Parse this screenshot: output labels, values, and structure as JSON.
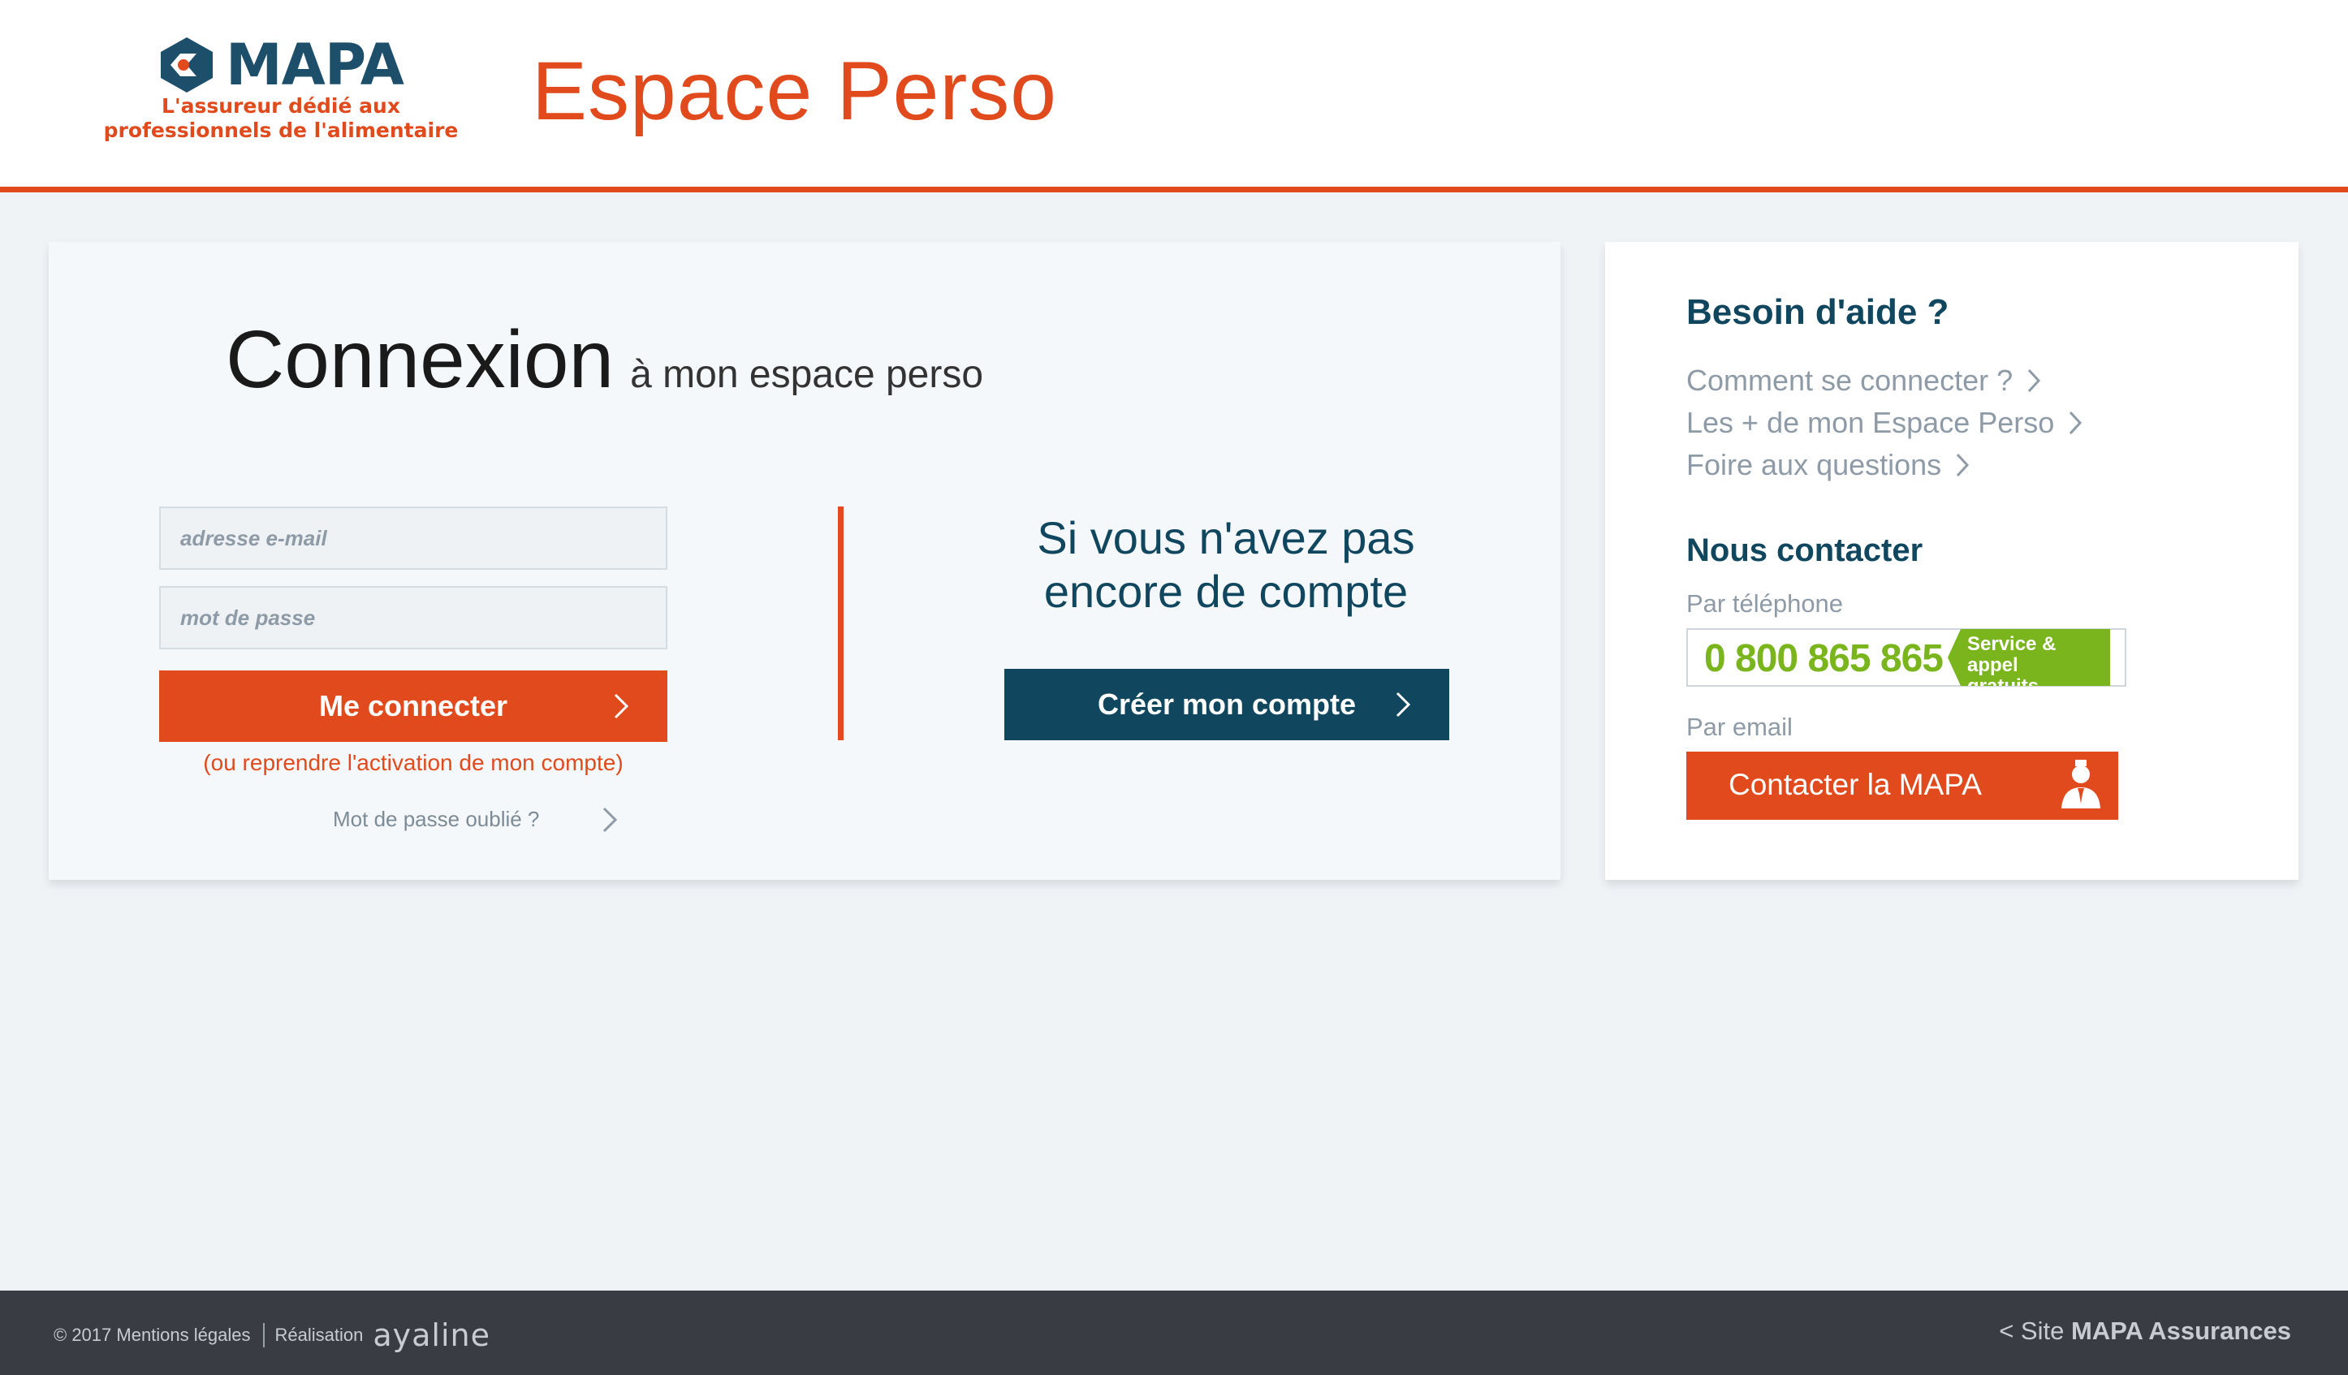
{
  "header": {
    "logo_word": "MAPA",
    "logo_tagline_1": "L'assureur dédié aux",
    "logo_tagline_2": "professionnels de l'alimentaire",
    "title": "Espace Perso"
  },
  "login": {
    "title_big": "Connexion",
    "title_small": "à mon espace perso",
    "email_placeholder": "adresse e-mail",
    "password_placeholder": "mot de passe",
    "login_button": "Me connecter",
    "resume_activation": "(ou reprendre l'activation de mon compte)",
    "forgot_password": "Mot de passe oublié ?"
  },
  "signup": {
    "line1": "Si vous n'avez pas",
    "line2": "encore de compte",
    "create_button": "Créer mon compte"
  },
  "help": {
    "title": "Besoin d'aide ?",
    "links": [
      "Comment se connecter ?",
      "Les + de mon Espace Perso",
      "Foire aux questions"
    ],
    "contact_title": "Nous contacter",
    "by_phone": "Par téléphone",
    "phone_number": "0 800 865 865",
    "phone_badge_1": "Service & appel",
    "phone_badge_2": "gratuits",
    "by_email": "Par email",
    "contact_button": "Contacter la MAPA"
  },
  "footer": {
    "copyright": "© 2017 Mentions légales",
    "made_by": "Réalisation",
    "agency": "ayaline",
    "back_prefix": "< Site ",
    "back_site": "MAPA Assurances"
  },
  "colors": {
    "accent": "#e04a1c",
    "navy": "#10475f",
    "green": "#7ab51d",
    "background": "#eff3f6",
    "footer": "#3a3c43"
  },
  "icons": [
    "mapa-logo-icon",
    "chevron-right-icon",
    "user-icon"
  ]
}
